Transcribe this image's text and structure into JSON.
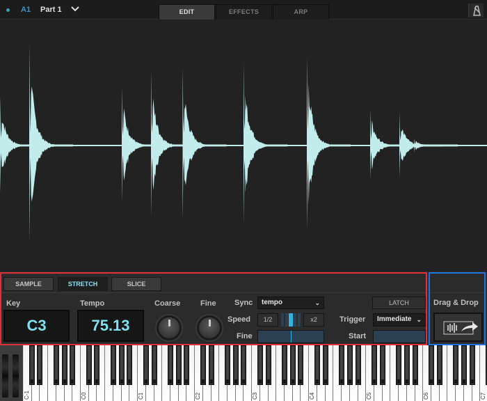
{
  "topbar": {
    "part_id": "A1",
    "part_name": "Part 1",
    "tabs": [
      {
        "label": "EDIT",
        "active": true
      },
      {
        "label": "EFFECTS",
        "active": false
      },
      {
        "label": "ARP",
        "active": false
      }
    ]
  },
  "waveform": {
    "color": "#c2ebec",
    "transients": [
      {
        "pos": 0.0,
        "amp": 0.42
      },
      {
        "pos": 0.06,
        "amp": 0.86
      },
      {
        "pos": 0.25,
        "amp": 0.5
      },
      {
        "pos": 0.31,
        "amp": 0.64
      },
      {
        "pos": 0.375,
        "amp": 0.66
      },
      {
        "pos": 0.5,
        "amp": 0.7
      },
      {
        "pos": 0.63,
        "amp": 0.75
      },
      {
        "pos": 0.76,
        "amp": 0.3
      },
      {
        "pos": 0.82,
        "amp": 0.28
      },
      {
        "pos": 0.85,
        "amp": 0.06
      }
    ]
  },
  "modes": [
    {
      "label": "SAMPLE",
      "active": false
    },
    {
      "label": "STRETCH",
      "active": true
    },
    {
      "label": "SLICE",
      "active": false
    }
  ],
  "controls": {
    "key_label": "Key",
    "key_value": "C3",
    "tempo_label": "Tempo",
    "tempo_value": "75.13",
    "coarse_label": "Coarse",
    "fine_knob_label": "Fine",
    "sync_label": "Sync",
    "sync_value": "tempo",
    "speed_label": "Speed",
    "speed_half": "1/2",
    "speed_double": "x2",
    "speed_selected_index": 2,
    "speed_steps": 5,
    "fine_label": "Fine",
    "fine_value": 0.5,
    "latch_label": "LATCH",
    "trigger_label": "Trigger",
    "trigger_value": "Immediate",
    "start_label": "Start",
    "drag_drop_label": "Drag & Drop"
  },
  "keyboard": {
    "octave_labels": [
      "C-1",
      "C0",
      "C1",
      "C2",
      "C3",
      "C4",
      "C5",
      "C6",
      "C7"
    ]
  }
}
